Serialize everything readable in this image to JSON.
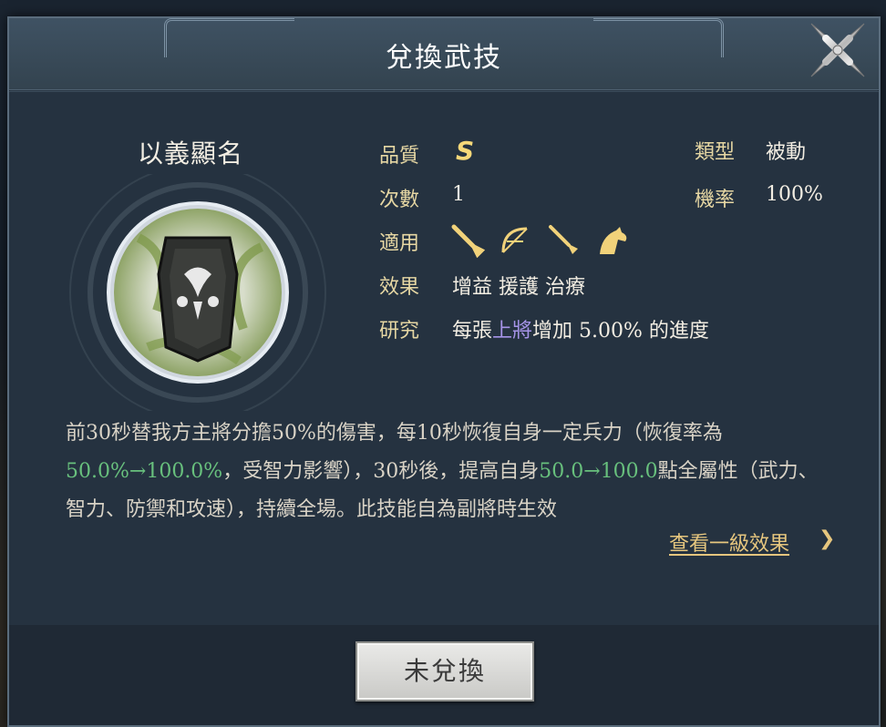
{
  "dialog": {
    "title": "兌換武技",
    "close_icon": "close-x-icon"
  },
  "skill": {
    "name": "以義顯名",
    "emblem_icon": "shield-crest-icon",
    "quality_label": "品質",
    "quality_value": "S",
    "type_label": "類型",
    "type_value": "被動",
    "count_label": "次數",
    "count_value": "1",
    "rate_label": "機率",
    "rate_value": "100%",
    "applicable_label": "適用",
    "applicable_icons": [
      "sword-icon",
      "bow-icon",
      "spear-icon",
      "horse-icon"
    ],
    "effect_label": "效果",
    "effect_value": "增益 援護 治療",
    "research_label": "研究",
    "research_prefix": "每張",
    "research_highlight": "上將",
    "research_suffix": "增加 5.00% 的進度"
  },
  "description": {
    "part1": "前30秒替我方主將分擔50%的傷害，每10秒恢復自身一定兵力（恢復率為",
    "green1": "50.0%→100.0%",
    "part2": "，受智力影響），30秒後，提高自身",
    "green2": "50.0→100.0",
    "part3": "點全屬性（武力、智力、防禦和攻速），持續全場。此技能自為副將時生效"
  },
  "view_level_link": "查看一級效果",
  "view_level_chevron": "❯",
  "action_button": "未兌換",
  "colors": {
    "accent_gold": "#e6d7a3",
    "highlight_purple": "#a694e8",
    "value_green": "#68c07d"
  }
}
